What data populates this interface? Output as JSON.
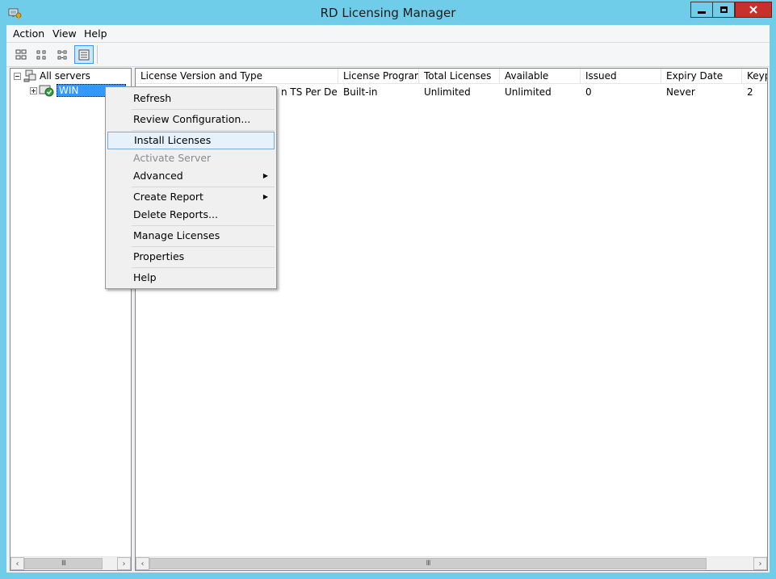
{
  "window": {
    "title": "RD Licensing Manager",
    "minimize_glyph": "—",
    "maximize_glyph": "☐",
    "close_glyph": "✕"
  },
  "menubar": {
    "items": [
      "Action",
      "View",
      "Help"
    ]
  },
  "toolbar": {
    "buttons": [
      "large-icons-view-icon",
      "small-icons-view-icon",
      "list-view-icon",
      "details-view-icon"
    ],
    "active": "details-view-icon"
  },
  "tree": {
    "root_label": "All servers",
    "server_label": "WIN"
  },
  "list": {
    "columns": [
      "License Version and Type",
      "License Program",
      "Total Licenses",
      "Available",
      "Issued",
      "Expiry Date",
      "Keyp"
    ],
    "rows": [
      {
        "license_version_and_type": "n TS Per De...",
        "license_program": "Built-in",
        "total_licenses": "Unlimited",
        "available": "Unlimited",
        "issued": "0",
        "expiry_date": "Never",
        "keypack": "2"
      }
    ]
  },
  "context_menu": {
    "items": {
      "refresh": "Refresh",
      "review_configuration": "Review Configuration...",
      "install_licenses": "Install Licenses",
      "activate_server": "Activate Server",
      "advanced": "Advanced",
      "create_report": "Create Report",
      "delete_reports": "Delete Reports...",
      "manage_licenses": "Manage Licenses",
      "properties": "Properties",
      "help": "Help"
    },
    "highlighted": "Install Licenses",
    "disabled": [
      "Activate Server"
    ]
  },
  "colors": {
    "titlebar": "#6fcde9",
    "close_button": "#c7302b",
    "selection": "#3399ff",
    "menu_hover": "#e5f1fb"
  }
}
